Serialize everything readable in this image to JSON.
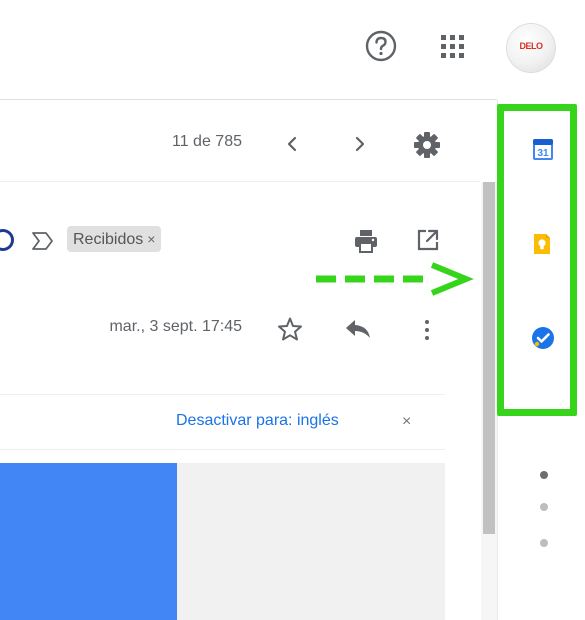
{
  "header": {
    "avatar_text": "DELO",
    "icons": [
      "help-icon",
      "apps-grid-icon"
    ]
  },
  "toolbar": {
    "page_counter": "11 de 785",
    "icons": [
      "chevron-left-icon",
      "chevron-right-icon",
      "gear-icon"
    ]
  },
  "message": {
    "label": "Recibidos",
    "label_close": "×",
    "timestamp": "mar., 3 sept. 17:45",
    "icons": [
      "important-marker-icon",
      "print-icon",
      "open-in-new-window-icon",
      "star-icon",
      "reply-icon",
      "more-vert-icon"
    ]
  },
  "translate": {
    "link": "Desactivar para: inglés",
    "close": "×"
  },
  "side_panel": {
    "calendar_day": "31",
    "icons": [
      "calendar-icon",
      "keep-icon",
      "tasks-icon"
    ]
  },
  "colors": {
    "highlight": "#36d51c",
    "link": "#1a73e8",
    "image_blue": "#4285f4"
  }
}
